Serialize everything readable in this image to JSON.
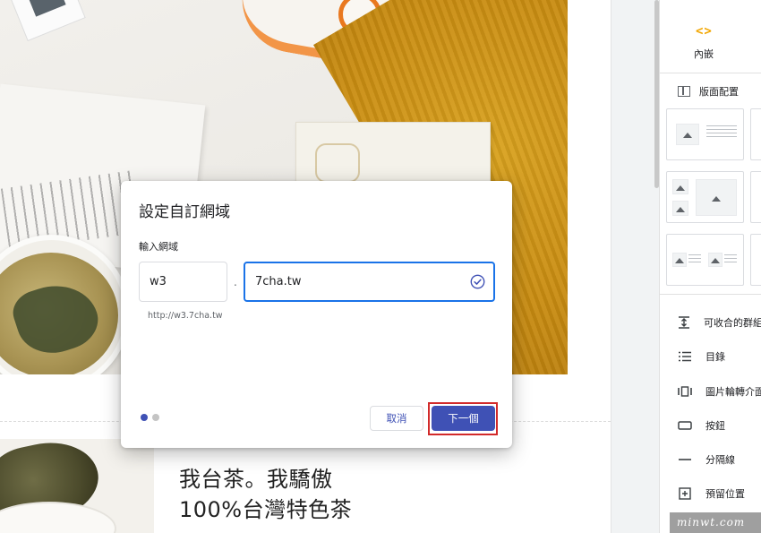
{
  "dialog": {
    "title": "設定自訂網域",
    "field_label": "輸入網域",
    "subdomain_value": "w3",
    "separator": ".",
    "domain_value": "7cha.tw",
    "url_preview": "http://w3.7cha.tw",
    "cancel_label": "取消",
    "next_label": "下一個",
    "pager": {
      "current": 1,
      "total": 2
    }
  },
  "page_content": {
    "heading_line1": "我台茶。我驕傲",
    "heading_line2": "100%台灣特色茶"
  },
  "sidebar": {
    "embed_icon": "<>",
    "embed_label": "內嵌",
    "layouts_label": "版面配置",
    "items": [
      {
        "label": "可收合的群組",
        "icon": "collapsible-group-icon"
      },
      {
        "label": "目錄",
        "icon": "table-of-contents-icon"
      },
      {
        "label": "圖片輪轉介面",
        "icon": "image-carousel-icon"
      },
      {
        "label": "按鈕",
        "icon": "button-icon"
      },
      {
        "label": "分隔線",
        "icon": "divider-icon"
      },
      {
        "label": "預留位置",
        "icon": "placeholder-icon"
      }
    ]
  },
  "watermark": "minwt.com",
  "colors": {
    "primary": "#3f51b5",
    "focus_border": "#1a73e8",
    "highlight_box": "#d22a2a",
    "embed_accent": "#f2a600"
  }
}
